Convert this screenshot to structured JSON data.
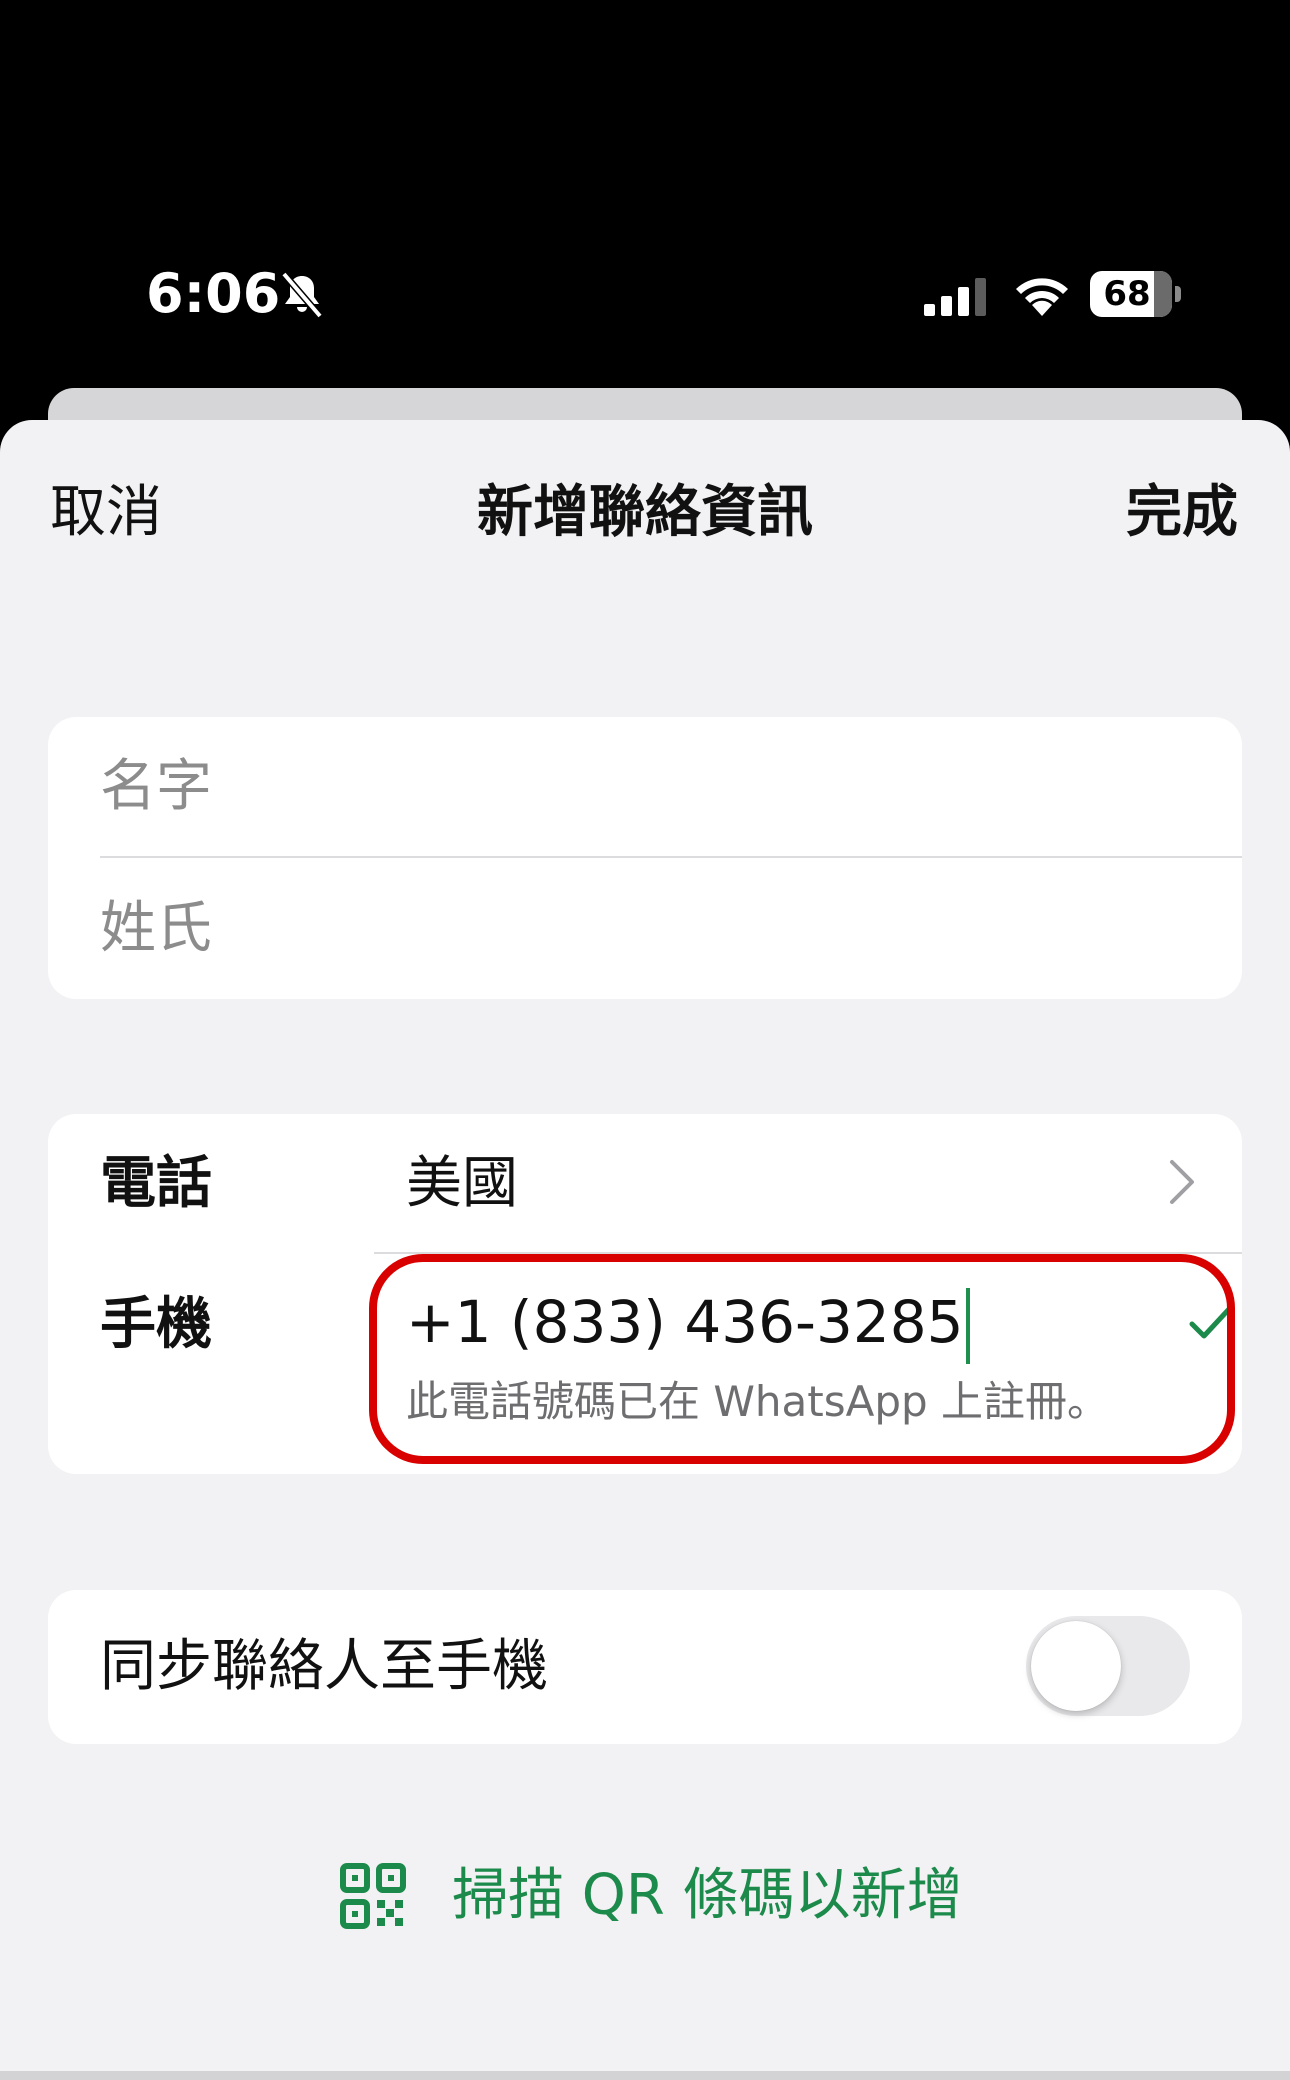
{
  "status_bar": {
    "time": "6:06",
    "battery_level": "68"
  },
  "nav": {
    "cancel_label": "取消",
    "title": "新增聯絡資訊",
    "done_label": "完成"
  },
  "name_fields": {
    "first_name_placeholder": "名字",
    "last_name_placeholder": "姓氏"
  },
  "phone": {
    "phone_label": "電話",
    "country": "美國",
    "mobile_label": "手機",
    "number": "+1  (833) 436-3285",
    "registered_note": "此電話號碼已在 WhatsApp 上註冊。"
  },
  "sync": {
    "label": "同步聯絡人至手機",
    "enabled": false
  },
  "qr": {
    "label": "掃描 QR 條碼以新增"
  },
  "colors": {
    "accent_green": "#1c8a4a",
    "highlight_red": "#d90000"
  }
}
